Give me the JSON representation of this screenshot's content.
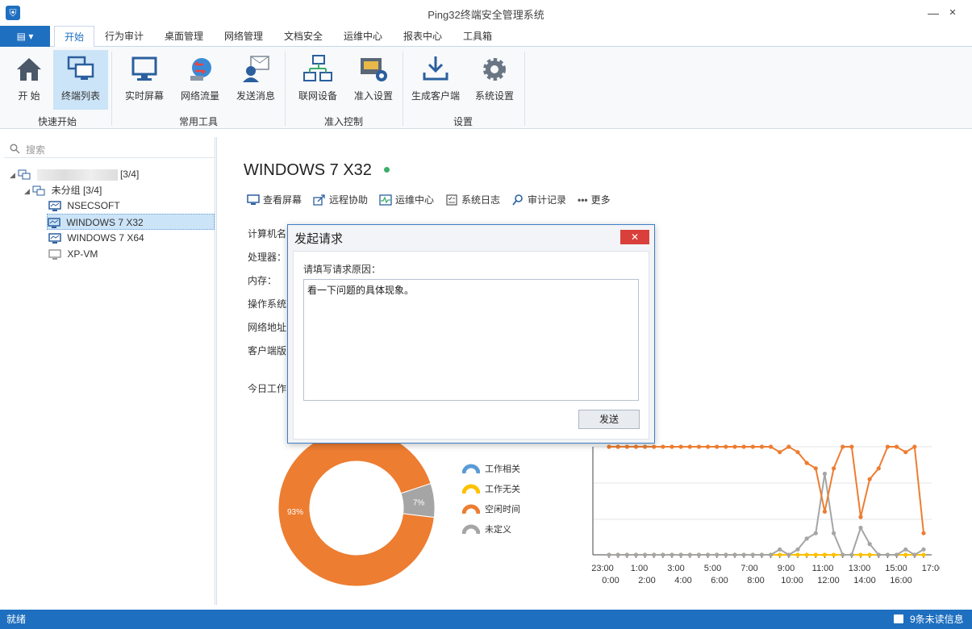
{
  "window": {
    "title": "Ping32终端安全管理系统",
    "minimize": "—",
    "maximize": "☐",
    "close": "✕"
  },
  "menu": {
    "app_button": "▤ ▾",
    "tabs": [
      "开始",
      "行为审计",
      "桌面管理",
      "网络管理",
      "文档安全",
      "运维中心",
      "报表中心",
      "工具箱"
    ]
  },
  "ribbon": {
    "buttons": [
      "开 始",
      "终端列表",
      "实时屏幕",
      "网络流量",
      "发送消息",
      "联网设备",
      "准入设置",
      "生成客户端",
      "系统设置"
    ],
    "groups": [
      "快速开始",
      "常用工具",
      "准入控制",
      "设置"
    ]
  },
  "sidebar": {
    "search_placeholder": "搜索",
    "root_count": "[3/4]",
    "group": "未分组  [3/4]",
    "devices": [
      "NSECSOFT",
      "WINDOWS 7 X32",
      "WINDOWS 7 X64",
      "XP-VM"
    ]
  },
  "device": {
    "name": "WINDOWS 7 X32",
    "actions": [
      "查看屏幕",
      "远程协助",
      "运维中心",
      "系统日志",
      "审计记录",
      "更多"
    ],
    "fields": [
      "计算机名",
      "处理器：",
      "内存：",
      "操作系统",
      "网络地址",
      "客户端版"
    ],
    "today_label": "今日工作"
  },
  "chart_data": [
    {
      "type": "pie",
      "labels": [
        "工作相关",
        "工作无关",
        "空闲时间",
        "未定义"
      ],
      "values": [
        0,
        0,
        93,
        7
      ],
      "value_labels": [
        "93%",
        "7%"
      ],
      "colors": {
        "工作相关": "#5b9bd5",
        "工作无关": "#ffc000",
        "空闲时间": "#ed7d31",
        "未定义": "#a5a5a5"
      }
    },
    {
      "type": "line",
      "x_labels_top": [
        "23:00",
        "1:00",
        "3:00",
        "5:00",
        "7:00",
        "9:00",
        "11:00",
        "13:00",
        "15:00",
        "17:00"
      ],
      "x_labels_bottom": [
        "0:00",
        "2:00",
        "4:00",
        "6:00",
        "8:00",
        "10:00",
        "12:00",
        "14:00",
        "16:00"
      ],
      "y_range": [
        0,
        100
      ],
      "series": [
        {
          "color": "#ed7d31",
          "values": [
            100,
            100,
            100,
            100,
            100,
            100,
            100,
            100,
            100,
            100,
            100,
            100,
            100,
            100,
            100,
            100,
            100,
            100,
            100,
            95,
            100,
            95,
            85,
            80,
            40,
            80,
            100,
            100,
            35,
            70,
            80,
            100,
            100,
            95,
            100,
            20
          ]
        },
        {
          "color": "#a5a5a5",
          "values": [
            0,
            0,
            0,
            0,
            0,
            0,
            0,
            0,
            0,
            0,
            0,
            0,
            0,
            0,
            0,
            0,
            0,
            0,
            0,
            5,
            0,
            5,
            15,
            20,
            75,
            20,
            0,
            0,
            25,
            10,
            0,
            0,
            0,
            5,
            0,
            5
          ]
        },
        {
          "color": "#ffc000",
          "values": [
            0,
            0,
            0,
            0,
            0,
            0,
            0,
            0,
            0,
            0,
            0,
            0,
            0,
            0,
            0,
            0,
            0,
            0,
            0,
            0,
            0,
            0,
            0,
            0,
            0,
            0,
            0,
            0,
            0,
            0,
            0,
            0,
            0,
            0,
            0,
            0
          ]
        }
      ]
    }
  ],
  "modal": {
    "title": "发起请求",
    "close": "✕",
    "label": "请填写请求原因：",
    "text": "看一下问题的具体现象。",
    "send": "发送"
  },
  "status": {
    "left": "就绪",
    "right": "9条未读信息"
  }
}
